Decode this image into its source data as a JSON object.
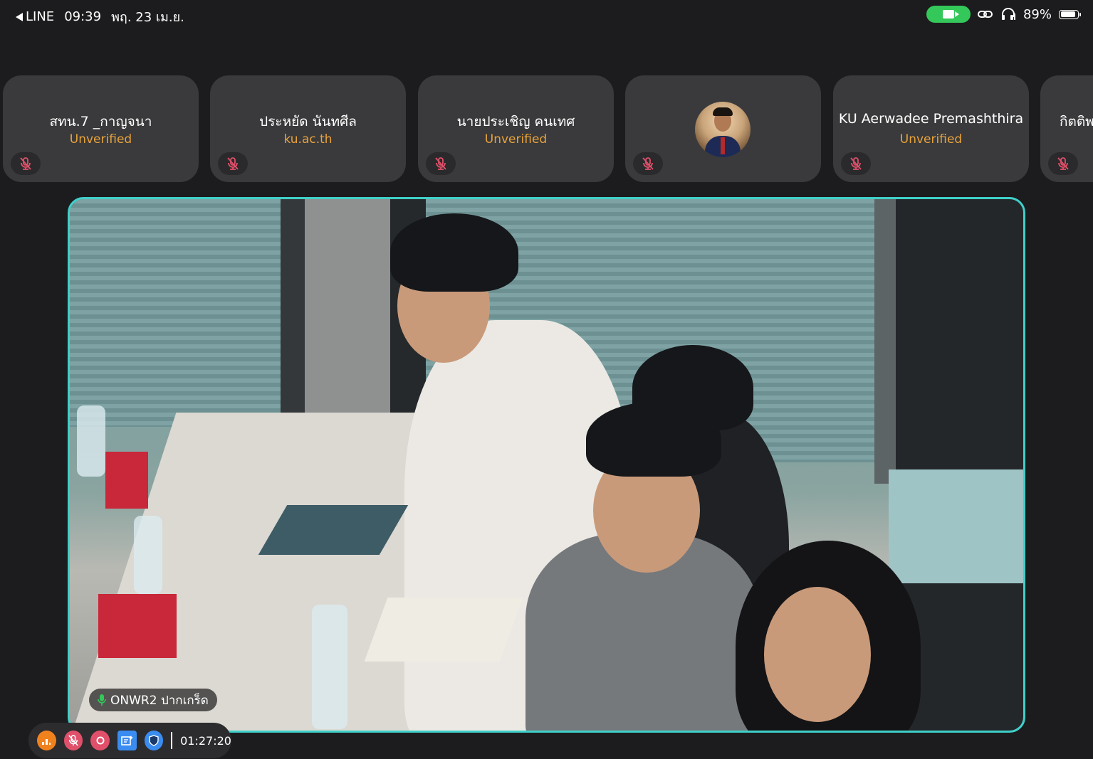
{
  "statusbar": {
    "back_app": "LINE",
    "time": "09:39",
    "date": "พฤ. 23 เม.ย.",
    "battery_percent": "89%",
    "battery_level": 0.89,
    "icons": [
      "camera-active-icon",
      "link-icon",
      "headphones-icon",
      "battery-icon"
    ]
  },
  "participants": [
    {
      "name": "สทน.7 _กาญจนา",
      "subtitle": "Unverified",
      "muted": true
    },
    {
      "name": "ประหยัด นันทศีล",
      "subtitle": "ku.ac.th",
      "muted": true
    },
    {
      "name": "นายประเชิญ  คนเทศ",
      "subtitle": "Unverified",
      "muted": true
    },
    {
      "name": "",
      "subtitle": "",
      "muted": true,
      "has_avatar": true
    },
    {
      "name": "KU Aerwadee Premashthira",
      "subtitle": "Unverified",
      "muted": true
    },
    {
      "name": "กิตติพ",
      "subtitle": "",
      "muted": true
    }
  ],
  "main_video": {
    "speaker_label": "ONWR2 ปากเกร็ด"
  },
  "toolbar": {
    "timer": "01:27:20",
    "colors": {
      "signal": "#f0821e",
      "mic": "#e0506a",
      "record": "#e0506a",
      "notes": "#3a8cf0",
      "shield": "#3a8cf0"
    }
  },
  "colors": {
    "accent_border": "#3fd0c9",
    "unverified": "#e9a33a",
    "tile_bg": "#3a3a3c"
  }
}
